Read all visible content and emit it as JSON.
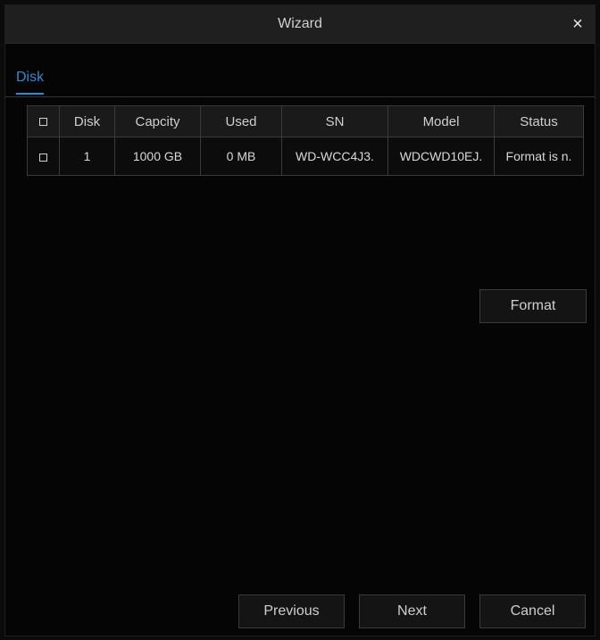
{
  "window": {
    "title": "Wizard",
    "close_glyph": "×",
    "close_icon": "close-icon"
  },
  "tabs": [
    {
      "label": "Disk",
      "active": true
    }
  ],
  "table": {
    "headers": [
      "",
      "Disk",
      "Capcity",
      "Used",
      "SN",
      "Model",
      "Status"
    ],
    "rows": [
      {
        "checked": false,
        "disk": "1",
        "capacity": "1000 GB",
        "used": "0 MB",
        "sn": "WD-WCC4J3.",
        "model": "WDCWD10EJ.",
        "status": "Format is n."
      }
    ]
  },
  "buttons": {
    "format": "Format",
    "previous": "Previous",
    "next": "Next",
    "cancel": "Cancel"
  },
  "colors": {
    "accent": "#2a8cd7",
    "background": "#050505",
    "titlebar": "#1f1f1f"
  }
}
